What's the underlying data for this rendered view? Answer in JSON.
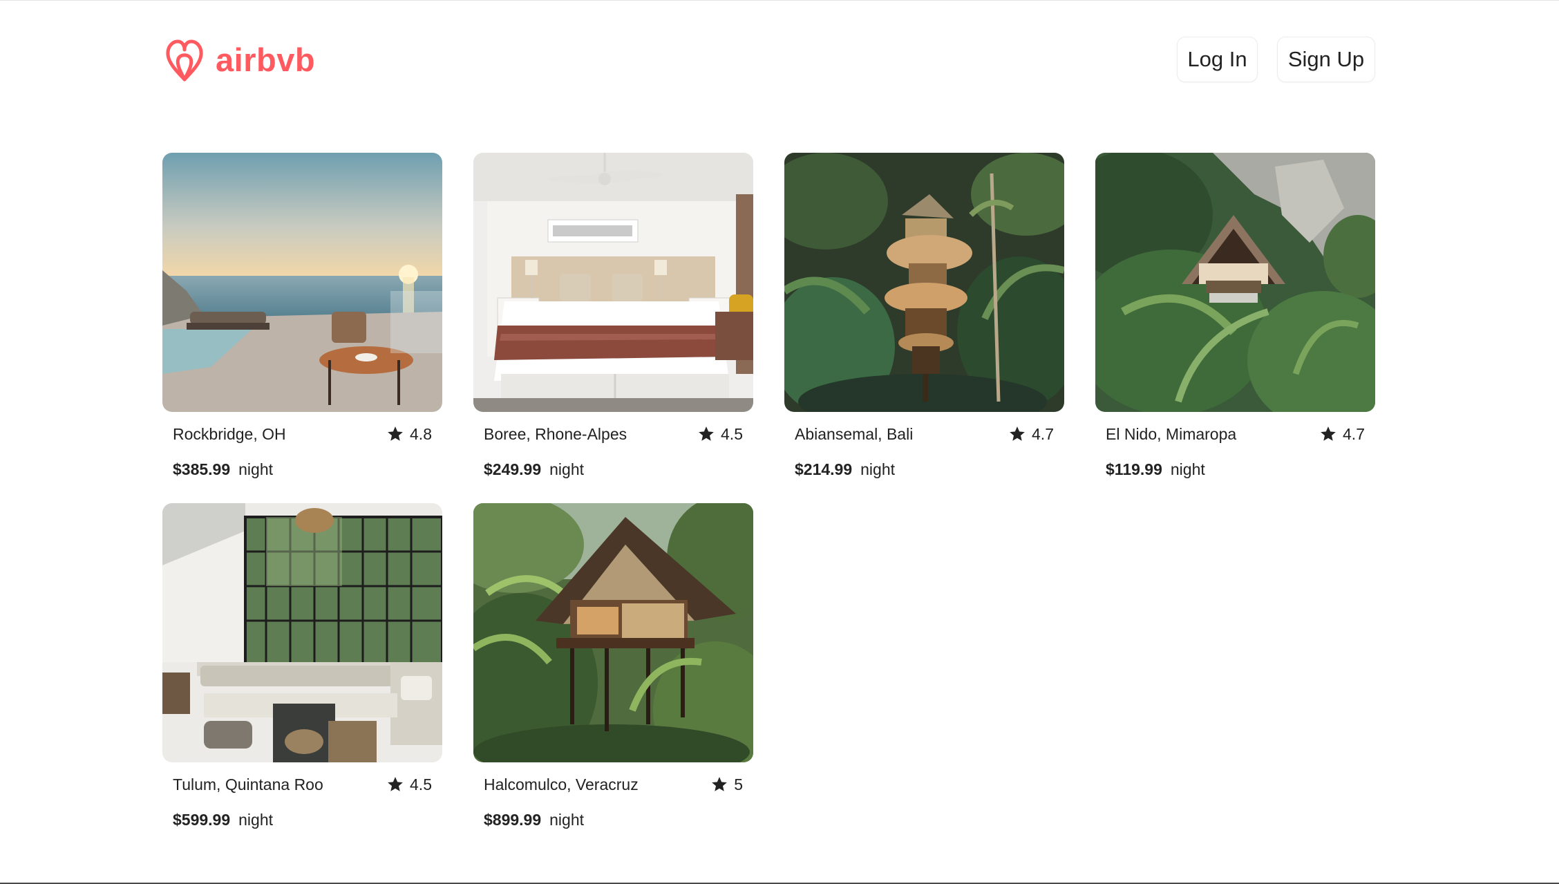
{
  "brand": {
    "name": "airbvb",
    "color": "#ff5a5f"
  },
  "header": {
    "login_label": "Log In",
    "signup_label": "Sign Up"
  },
  "listings": [
    {
      "location": "Rockbridge, OH",
      "rating": "4.8",
      "price": "$385.99",
      "unit": "night",
      "photo": "ocean-terrace-sunset"
    },
    {
      "location": "Boree, Rhone-Alpes",
      "rating": "4.5",
      "price": "$249.99",
      "unit": "night",
      "photo": "white-bedroom"
    },
    {
      "location": "Abiansemal, Bali",
      "rating": "4.7",
      "price": "$214.99",
      "unit": "night",
      "photo": "bamboo-treehouse-jungle"
    },
    {
      "location": "El Nido, Mimaropa",
      "rating": "4.7",
      "price": "$119.99",
      "unit": "night",
      "photo": "hut-by-cliff-jungle"
    },
    {
      "location": "Tulum, Quintana Roo",
      "rating": "4.5",
      "price": "$599.99",
      "unit": "night",
      "photo": "sunken-lounge-glass-walls"
    },
    {
      "location": "Halcomulco, Veracruz",
      "rating": "5",
      "price": "$899.99",
      "unit": "night",
      "photo": "stilt-cabin-forest"
    }
  ]
}
